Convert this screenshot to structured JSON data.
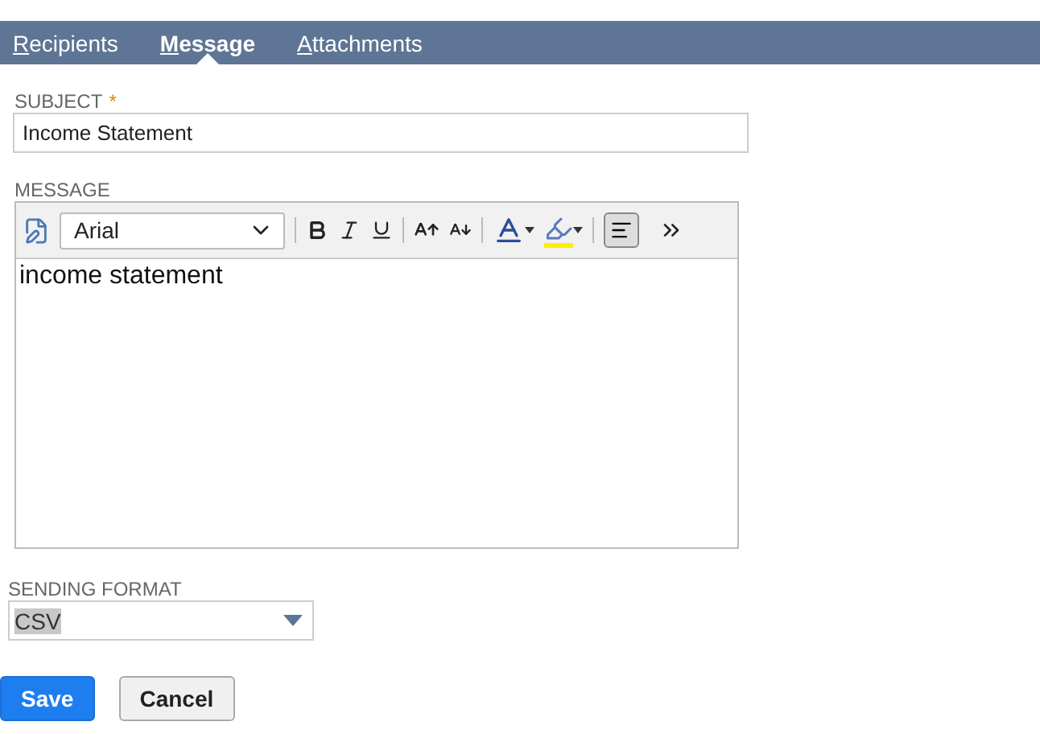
{
  "tabs": [
    {
      "key": "R",
      "rest": "ecipients",
      "selected": false
    },
    {
      "key": "M",
      "rest": "essage",
      "selected": true
    },
    {
      "key": "A",
      "rest": "ttachments",
      "selected": false
    }
  ],
  "subject": {
    "label": "SUBJECT",
    "required_mark": "*",
    "value": "Income Statement"
  },
  "message": {
    "label": "MESSAGE",
    "font": "Arial",
    "body": "income statement"
  },
  "sending_format": {
    "label": "SENDING FORMAT",
    "value": "CSV"
  },
  "buttons": [
    {
      "label": "Save",
      "kind": "primary"
    },
    {
      "label": "Cancel",
      "kind": "secondary"
    }
  ]
}
